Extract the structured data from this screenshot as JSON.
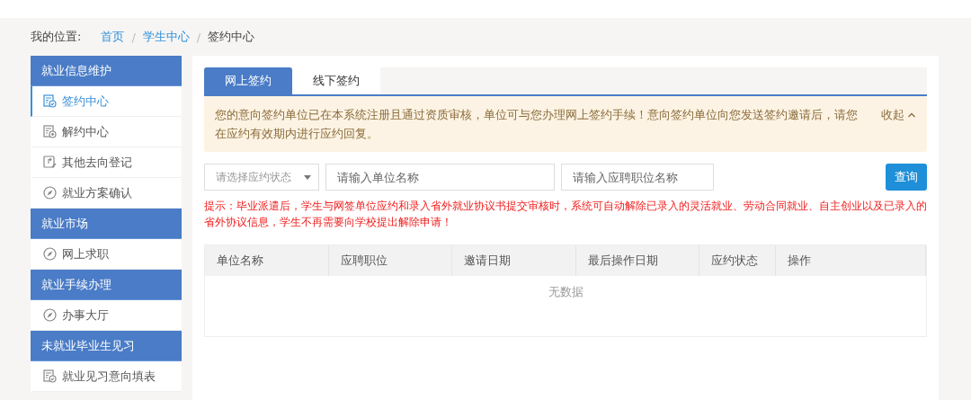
{
  "breadcrumb": {
    "label": "我的位置:",
    "items": [
      {
        "text": "首页",
        "kind": "link"
      },
      {
        "text": "学生中心",
        "kind": "link"
      },
      {
        "text": "签约中心",
        "kind": "current"
      }
    ],
    "separator": "/"
  },
  "sidebar": {
    "groups": [
      {
        "title": "就业信息维护",
        "items": [
          {
            "label": "签约中心",
            "selected": true
          },
          {
            "label": "解约中心",
            "selected": false
          },
          {
            "label": "其他去向登记",
            "selected": false
          },
          {
            "label": "就业方案确认",
            "selected": false
          }
        ]
      },
      {
        "title": "就业市场",
        "items": [
          {
            "label": "网上求职",
            "selected": false
          }
        ]
      },
      {
        "title": "就业手续办理",
        "items": [
          {
            "label": "办事大厅",
            "selected": false
          }
        ]
      },
      {
        "title": "未就业毕业生见习",
        "items": [
          {
            "label": "就业见习意向填表",
            "selected": false
          }
        ]
      }
    ]
  },
  "tabs": [
    {
      "label": "网上签约",
      "selected": true
    },
    {
      "label": "线下签约",
      "selected": false
    }
  ],
  "notice": {
    "text": "您的意向签约单位已在本系统注册且通过资质审核，单位可与您办理网上签约手续！意向签约单位向您发送签约邀请后，请您在应约有效期内进行应约回复。",
    "collapse": "收起"
  },
  "filters": {
    "status_select": {
      "placeholder": "请选择应约状态"
    },
    "company_field": {
      "placeholder": "请输入单位名称"
    },
    "position_field": {
      "placeholder": "请输入应聘职位名称"
    },
    "query_button": "查询"
  },
  "hint": "提示：毕业派遣后，学生与网签单位应约和录入省外就业协议书提交审核时，系统可自动解除已录入的灵活就业、劳动合同就业、自主创业以及已录入的省外协议信息，学生不再需要向学校提出解除申请！",
  "table": {
    "columns": [
      "单位名称",
      "应聘职位",
      "邀请日期",
      "最后操作日期",
      "应约状态",
      "操作"
    ],
    "empty_text": "无数据"
  }
}
